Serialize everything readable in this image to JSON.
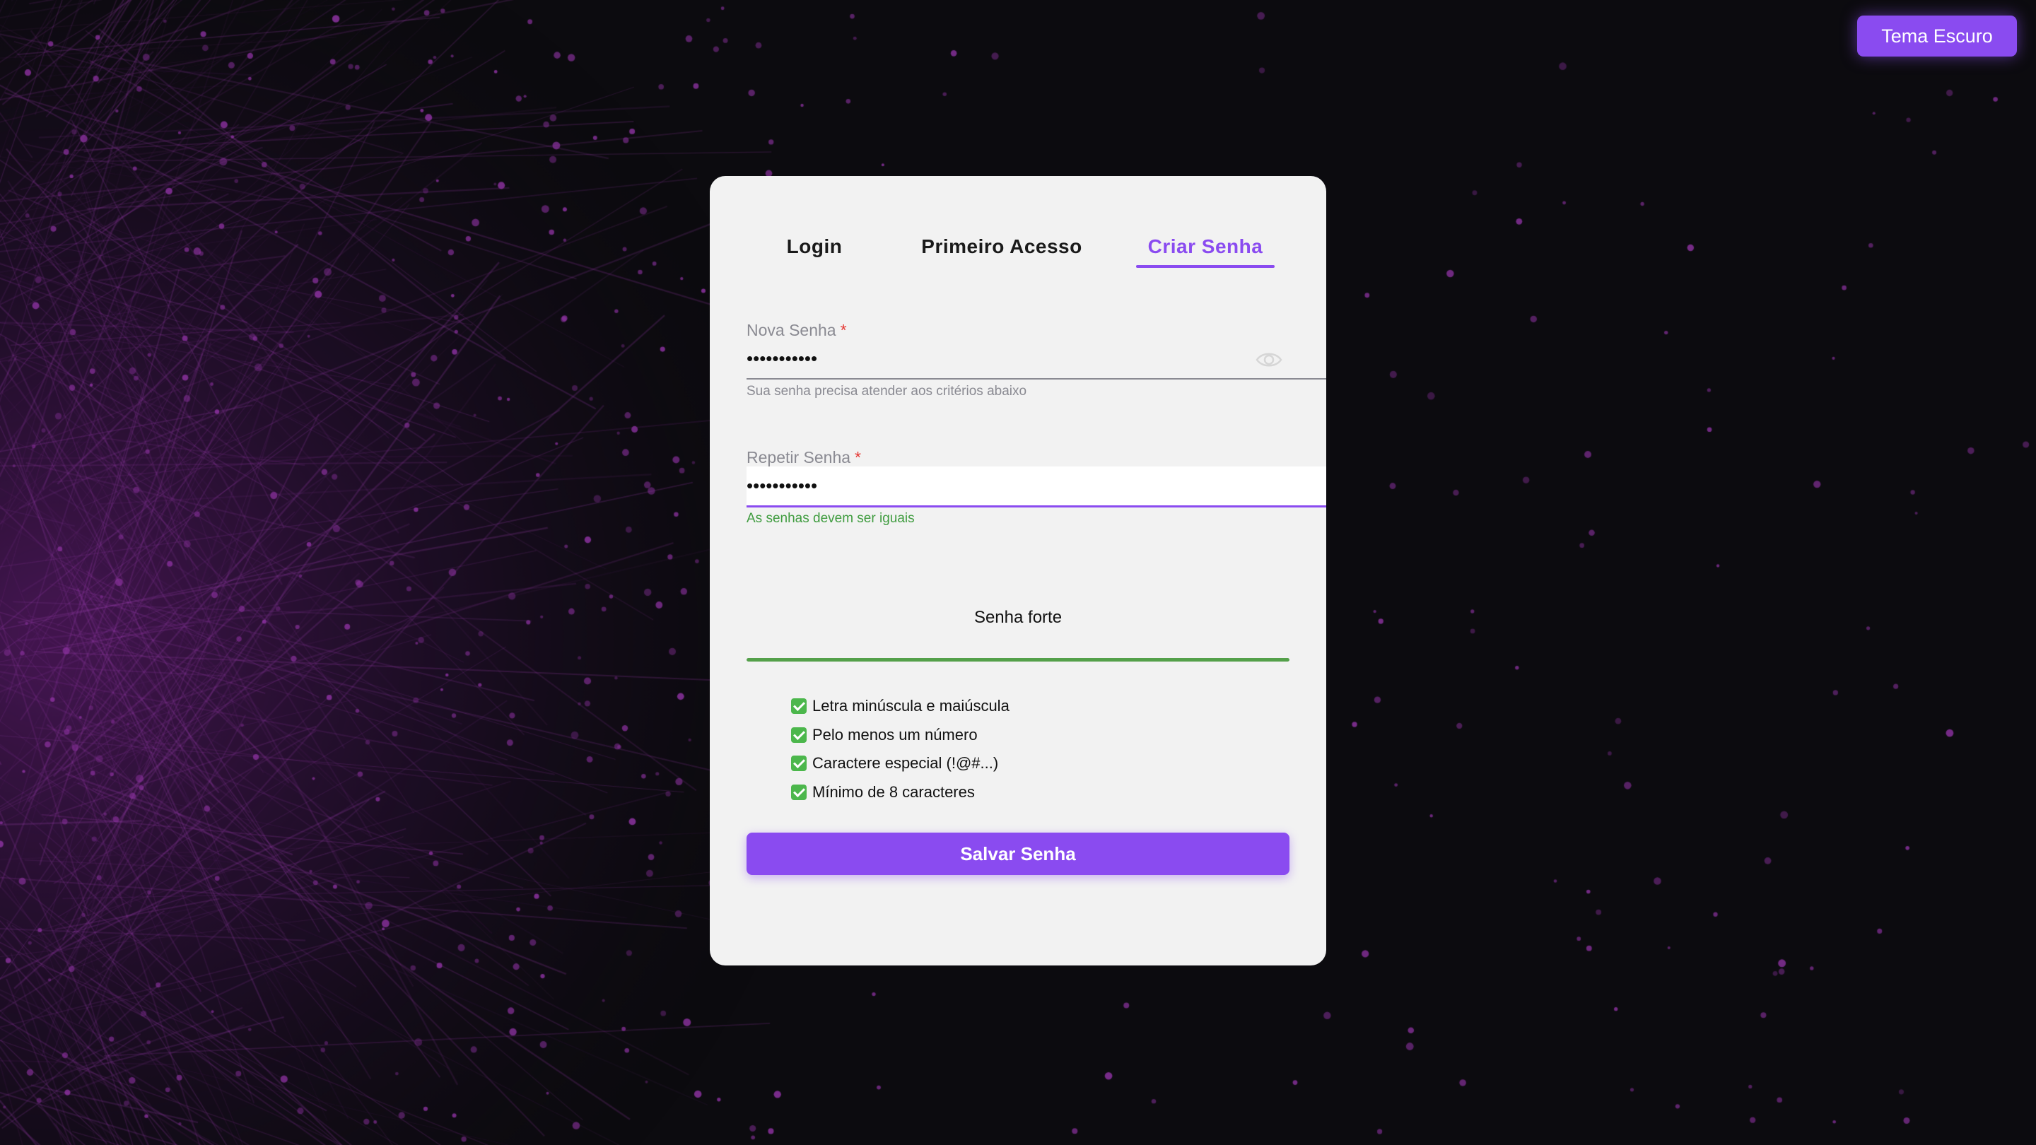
{
  "header": {
    "theme_button_label": "Tema Escuro"
  },
  "tabs": [
    {
      "label": "Login",
      "active": false
    },
    {
      "label": "Primeiro Acesso",
      "active": false
    },
    {
      "label": "Criar Senha",
      "active": true
    }
  ],
  "form": {
    "new_password": {
      "label": "Nova Senha",
      "required_mark": "*",
      "value": "•••••••••••",
      "helper": "Sua senha precisa atender aos critérios abaixo",
      "toggle_icon": "eye-icon"
    },
    "repeat_password": {
      "label": "Repetir Senha",
      "required_mark": "*",
      "value": "•••••••••••",
      "helper": "As senhas devem ser iguais"
    },
    "strength": {
      "label": "Senha forte",
      "level": 1.0,
      "color": "#54a04a"
    },
    "criteria": [
      {
        "label": "Letra minúscula e maiúscula",
        "met": true
      },
      {
        "label": "Pelo menos um número",
        "met": true
      },
      {
        "label": "Caractere especial (!@#...)",
        "met": true
      },
      {
        "label": "Mínimo de 8 caracteres",
        "met": true
      }
    ],
    "submit_label": "Salvar Senha"
  },
  "colors": {
    "accent": "#8a4bf0",
    "success": "#3f9c3f",
    "required": "#e53935",
    "background": "#0c0b0f",
    "card": "#f2f2f2"
  }
}
